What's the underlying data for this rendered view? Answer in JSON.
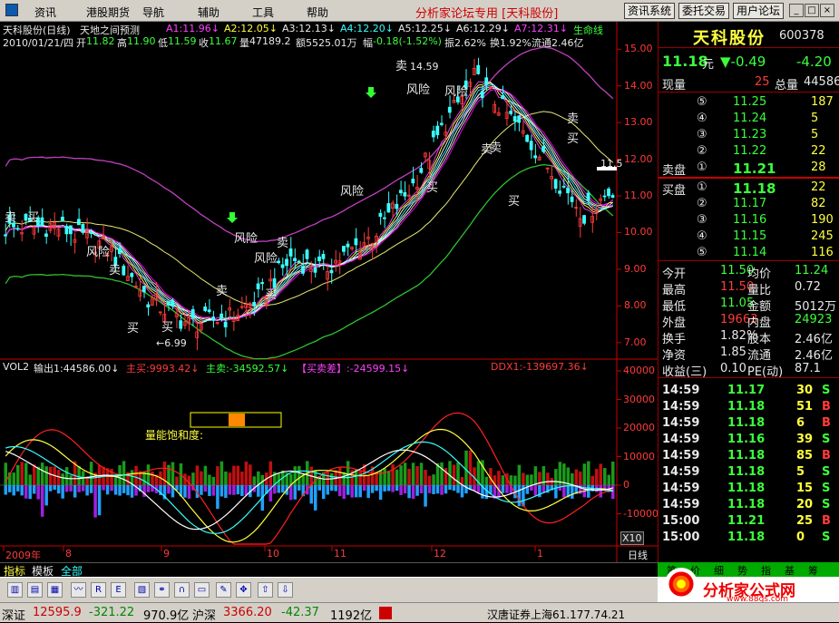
{
  "menu": {
    "items": [
      "资讯",
      "港股期货",
      "导航",
      "辅助",
      "工具",
      "帮助"
    ],
    "app_title": "分析家论坛专用 [天科股份]",
    "buttons": [
      "资讯系统",
      "委托交易",
      "用户论坛"
    ],
    "window_controls": [
      "_",
      "□",
      "×"
    ]
  },
  "chart_header": {
    "line1": {
      "stock": "天科股份(日线)",
      "indicator": "天地之间预测",
      "ma": [
        "A1:11.96↓",
        "A2:12.05↓",
        "A3:12.13↓",
        "A4:12.20↓",
        "A5:12.25↓",
        "A6:12.29↓",
        "A7:12.31↓"
      ],
      "extra": "生命线"
    },
    "line2": {
      "date": "2010/01/21/四",
      "open_label": "开",
      "open": "11.82",
      "high_label": "高",
      "high": "11.90",
      "low_label": "低",
      "low": "11.59",
      "close_label": "收",
      "close": "11.67",
      "volume_label": "量",
      "volume": "47189.2",
      "amount_label": "额",
      "amount": "5525.01万",
      "change_label": "幅",
      "change": "-0.18(-1.52%)",
      "amplitude": "振2.62%",
      "turnover": "换1.92%",
      "float": "流通2.46亿"
    }
  },
  "chart_labels": {
    "high_price": "14.59",
    "low_price": "6.99",
    "last_price_tag": "11.5",
    "signals": [
      "卖",
      "买",
      "风险",
      "买",
      "卖",
      "风险",
      "买",
      "卖",
      "风险",
      "风险",
      "买",
      "卖",
      "卖",
      "买",
      "卖",
      "卖",
      "买",
      "买",
      "卖",
      "风险",
      "风险"
    ]
  },
  "price_axis": [
    "15.00",
    "14.00",
    "13.00",
    "12.00",
    "11.00",
    "10.00",
    "9.00",
    "8.00",
    "7.00"
  ],
  "vol_panel": {
    "name": "VOL2",
    "output": "输出1:44586.00↓",
    "main_buy": "主买:9993.42↓",
    "main_sell": "主卖:-34592.57↓",
    "diff": "【买卖差】:-24599.15↓",
    "ddx": "DDX1:-139697.36↓",
    "saturation_label": "量能饱和度:",
    "axis": [
      "40000",
      "30000",
      "20000",
      "10000",
      "0",
      "-10000"
    ],
    "axis_unit": "X10"
  },
  "time_axis": {
    "labels": [
      "2009年",
      "8",
      "9",
      "10",
      "11",
      "12",
      "1"
    ],
    "period": "日线"
  },
  "bottom_tabs": [
    "指标",
    "模板",
    "全部"
  ],
  "quote": {
    "name": "天科股份",
    "code": "600378",
    "price": "11.18",
    "price_unit": "元",
    "change": "▼-0.49",
    "change_pct": "-4.20",
    "current_vol_label": "现量",
    "current_vol": "25",
    "total_vol_label": "总量",
    "total_vol": "44586",
    "sell_label": "卖盘",
    "buy_label": "买盘",
    "sells": [
      {
        "lvl": "⑤",
        "price": "11.25",
        "vol": "187"
      },
      {
        "lvl": "④",
        "price": "11.24",
        "vol": "5"
      },
      {
        "lvl": "③",
        "price": "11.23",
        "vol": "5"
      },
      {
        "lvl": "②",
        "price": "11.22",
        "vol": "22"
      },
      {
        "lvl": "①",
        "price": "11.21",
        "vol": "28"
      }
    ],
    "buys": [
      {
        "lvl": "①",
        "price": "11.18",
        "vol": "22"
      },
      {
        "lvl": "②",
        "price": "11.17",
        "vol": "82"
      },
      {
        "lvl": "③",
        "price": "11.16",
        "vol": "190"
      },
      {
        "lvl": "④",
        "price": "11.15",
        "vol": "245"
      },
      {
        "lvl": "⑤",
        "price": "11.14",
        "vol": "116"
      }
    ],
    "stats": [
      {
        "l1": "今开",
        "v1": "11.50",
        "l2": "均价",
        "v2": "11.24"
      },
      {
        "l1": "最高",
        "v1": "11.50",
        "l2": "量比",
        "v2": "0.72"
      },
      {
        "l1": "最低",
        "v1": "11.05",
        "l2": "金额",
        "v2": "5012万"
      },
      {
        "l1": "外盘",
        "v1": "19663",
        "l2": "内盘",
        "v2": "24923"
      },
      {
        "l1": "换手",
        "v1": "1.82%",
        "l2": "股本",
        "v2": "2.46亿"
      },
      {
        "l1": "净资",
        "v1": "1.85",
        "l2": "流通",
        "v2": "2.46亿"
      },
      {
        "l1": "收益(三)",
        "v1": "0.10",
        "l2": "PE(动)",
        "v2": "87.1"
      }
    ],
    "ticks": [
      {
        "time": "14:59",
        "price": "11.17",
        "vol": "30",
        "bs": "S"
      },
      {
        "time": "14:59",
        "price": "11.18",
        "vol": "51",
        "bs": "B"
      },
      {
        "time": "14:59",
        "price": "11.18",
        "vol": "6",
        "bs": "B"
      },
      {
        "time": "14:59",
        "price": "11.16",
        "vol": "39",
        "bs": "S"
      },
      {
        "time": "14:59",
        "price": "11.18",
        "vol": "85",
        "bs": "B"
      },
      {
        "time": "14:59",
        "price": "11.18",
        "vol": "5",
        "bs": "S"
      },
      {
        "time": "14:59",
        "price": "11.18",
        "vol": "15",
        "bs": "S"
      },
      {
        "time": "14:59",
        "price": "11.18",
        "vol": "20",
        "bs": "S"
      },
      {
        "time": "15:00",
        "price": "11.21",
        "vol": "25",
        "bs": "B"
      },
      {
        "time": "15:00",
        "price": "11.18",
        "vol": "0",
        "bs": "S"
      }
    ],
    "bottom_tabs": [
      "笔",
      "价",
      "细",
      "势",
      "指",
      "基",
      "筹"
    ]
  },
  "ad": {
    "title": "分析家公式网",
    "url": "www.88gs.com"
  },
  "status": {
    "sz_label": "深证",
    "sz_index": "12595.9",
    "sz_change": "-321.22",
    "sz_amount": "970.9亿",
    "hs_label": "沪深",
    "hs_index": "3366.20",
    "hs_change": "-42.37",
    "hs_amount": "1192亿",
    "broker": "汉唐证券上海61.177.74.21"
  },
  "colors": {
    "up": "#ff3b3b",
    "down": "#3bff3b",
    "ma_white": "#ffffff",
    "life_line": "#c040c0",
    "yellow": "#ffff40"
  }
}
